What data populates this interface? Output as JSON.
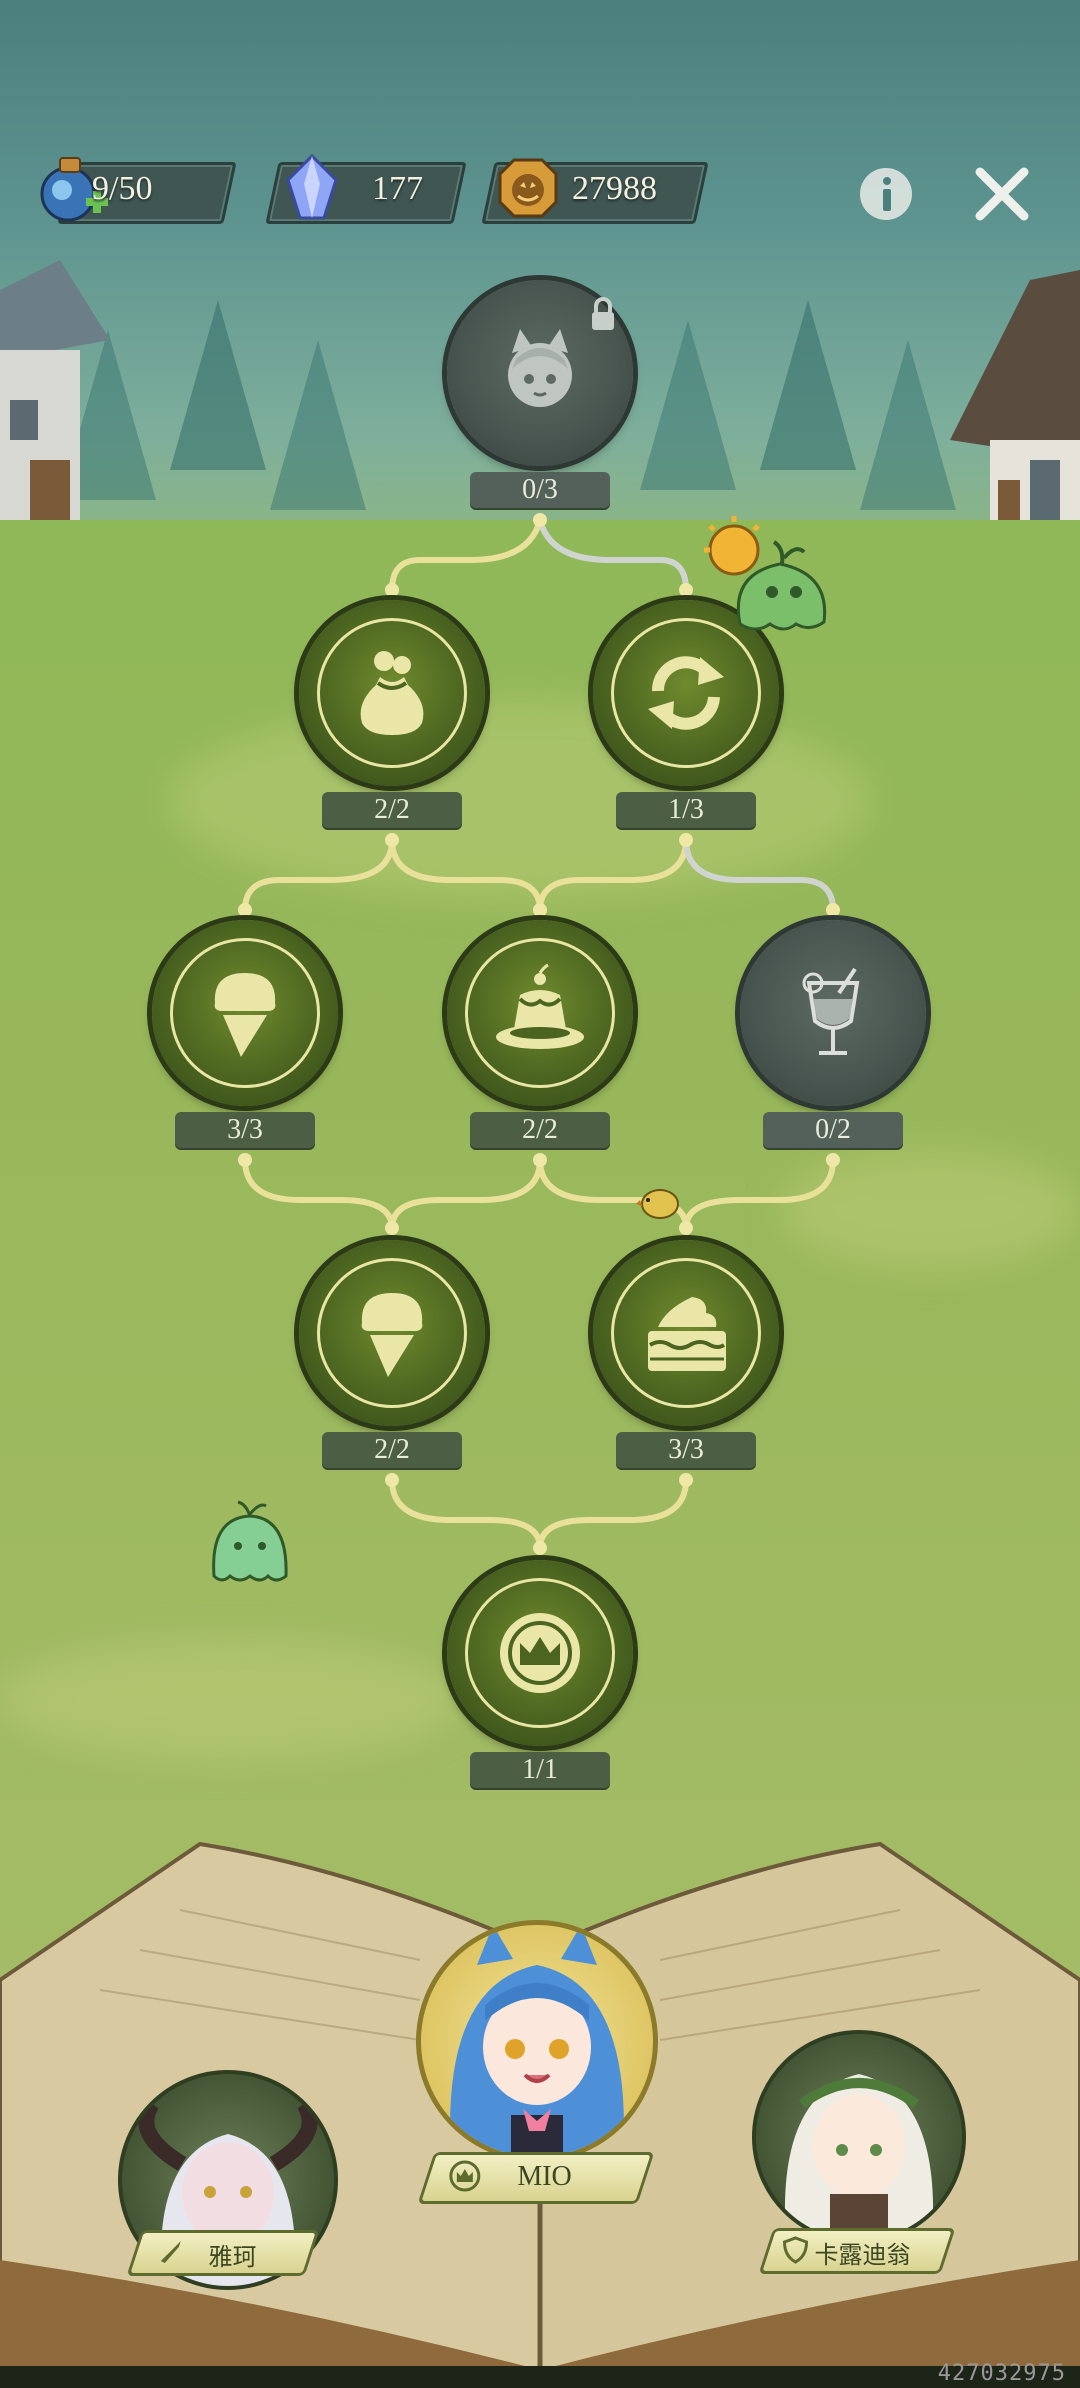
{
  "resources": {
    "stamina": "9/50",
    "crystals": "177",
    "coins": "27988"
  },
  "buttons": {
    "info_icon": "info-icon",
    "close_icon": "close-icon"
  },
  "nodes": [
    {
      "id": "top",
      "icon": "catgirl-portrait-icon",
      "count": "0/3",
      "locked": true
    },
    {
      "id": "r2a",
      "icon": "coin-bag-icon",
      "count": "2/2",
      "locked": false
    },
    {
      "id": "r2b",
      "icon": "refresh-icon",
      "count": "1/3",
      "locked": false
    },
    {
      "id": "r3a",
      "icon": "ice-cream-icon",
      "count": "3/3",
      "locked": false
    },
    {
      "id": "r3b",
      "icon": "pudding-icon",
      "count": "2/2",
      "locked": false
    },
    {
      "id": "r3c",
      "icon": "drink-glass-icon",
      "count": "0/2",
      "locked": true
    },
    {
      "id": "r4a",
      "icon": "ice-cream-icon",
      "count": "2/2",
      "locked": false
    },
    {
      "id": "r4b",
      "icon": "cake-slice-icon",
      "count": "3/3",
      "locked": false
    },
    {
      "id": "root",
      "icon": "crown-badge-icon",
      "count": "1/1",
      "locked": false
    }
  ],
  "characters": {
    "left": "雅珂",
    "center": "MIO",
    "right": "卡露迪翁"
  },
  "corner_id": "427032975",
  "colors": {
    "node_green": "#4b6420",
    "ring": "#e9e6a4",
    "path_active": "#e9e09a",
    "path_inactive": "#d0d4cf",
    "locked_node": "#48544f"
  }
}
